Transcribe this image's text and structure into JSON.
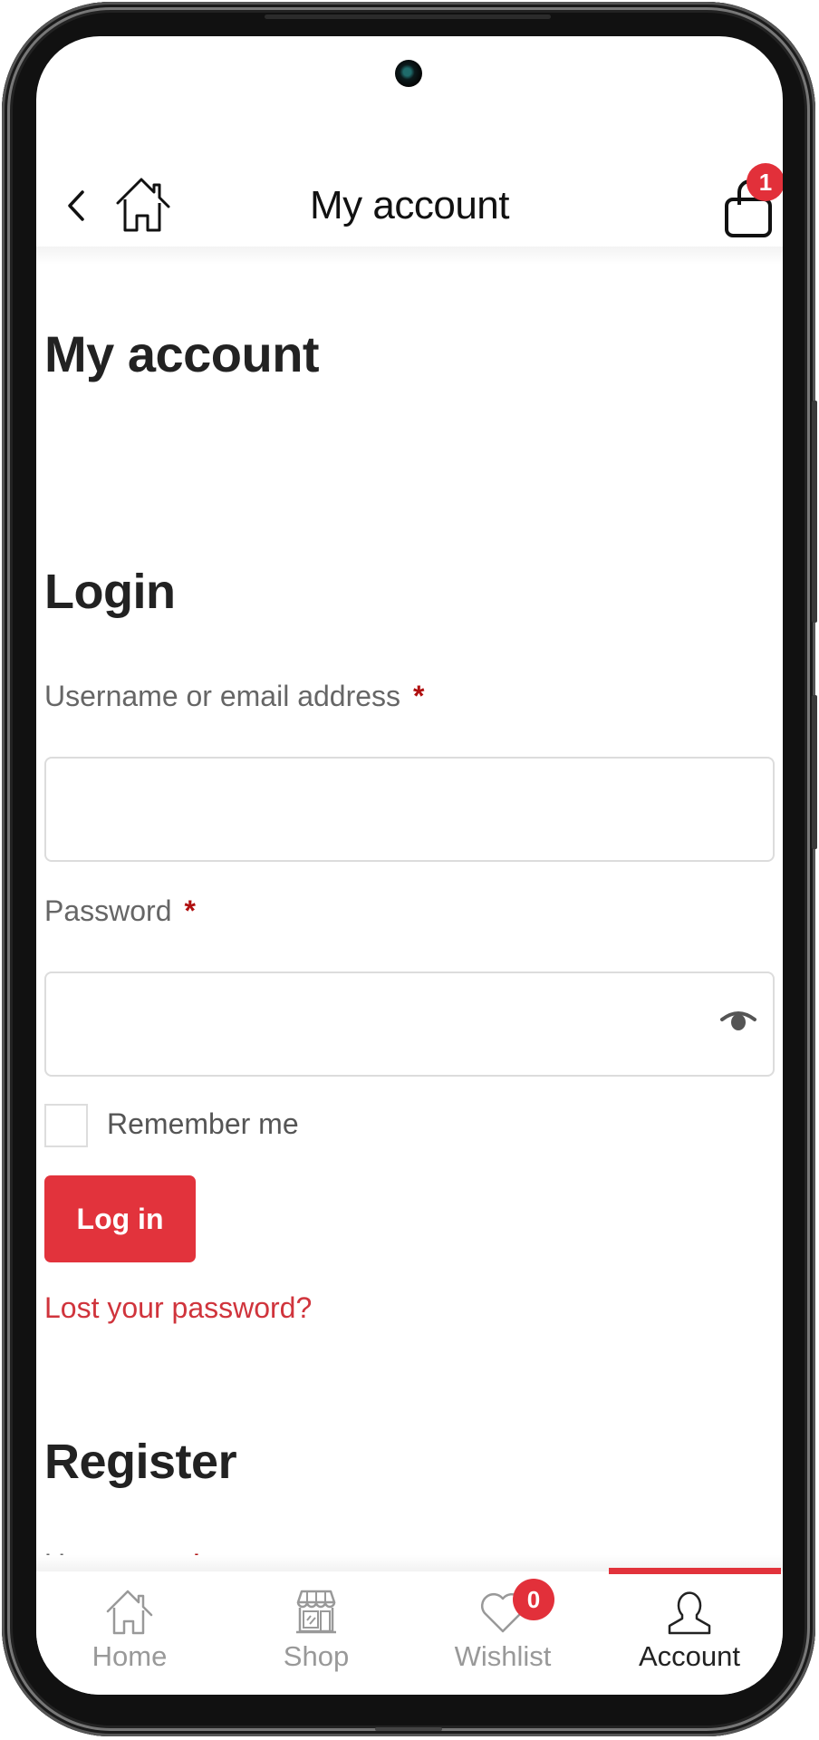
{
  "header": {
    "title": "My account",
    "back_icon": "chevron-left-icon",
    "home_icon": "home-icon",
    "cart_icon": "shopping-bag-icon",
    "cart_count": "1"
  },
  "page": {
    "heading": "My account"
  },
  "login": {
    "heading": "Login",
    "username_label": "Username or email address",
    "username_value": "",
    "password_label": "Password",
    "password_value": "",
    "required_mark": "*",
    "show_password_icon": "eye-icon",
    "remember_label": "Remember me",
    "remember_checked": false,
    "submit_label": "Log in",
    "lost_password_label": "Lost your password?"
  },
  "register": {
    "heading": "Register",
    "username_label": "Username",
    "required_mark": "*"
  },
  "bottom_nav": {
    "items": [
      {
        "label": "Home",
        "icon": "home-icon",
        "active": false
      },
      {
        "label": "Shop",
        "icon": "store-icon",
        "active": false
      },
      {
        "label": "Wishlist",
        "icon": "heart-icon",
        "active": false,
        "badge": "0"
      },
      {
        "label": "Account",
        "icon": "user-icon",
        "active": true
      }
    ]
  },
  "colors": {
    "accent": "#e2333c",
    "link": "#d0343c",
    "required": "#b01010",
    "text": "#222222",
    "muted": "#999999"
  }
}
